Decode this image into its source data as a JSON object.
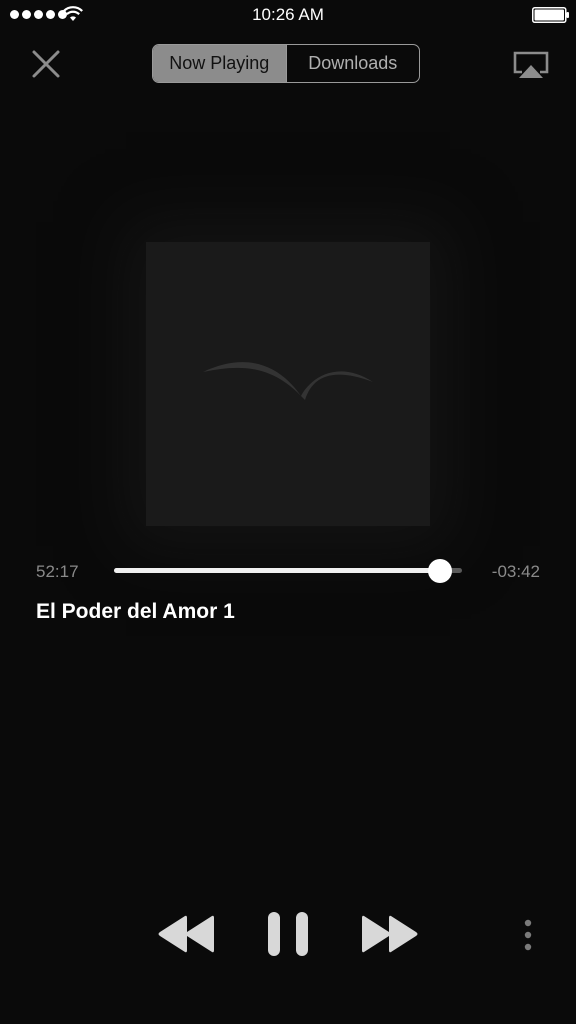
{
  "status_bar": {
    "time": "10:26 AM",
    "signal_bars": 5
  },
  "header": {
    "tabs": [
      {
        "label": "Now Playing",
        "selected": true
      },
      {
        "label": "Downloads",
        "selected": false
      }
    ],
    "close_icon": "close-icon",
    "airplay_icon": "airplay-icon"
  },
  "player": {
    "elapsed": "52:17",
    "remaining": "-03:42",
    "progress": 0.938,
    "title": "El Poder del Amor 1",
    "is_playing": true
  },
  "controls": {
    "rewind_icon": "rewind-icon",
    "pause_icon": "pause-icon",
    "forward_icon": "fast-forward-icon",
    "more_icon": "more-vertical-icon"
  },
  "colors": {
    "background": "#0a0a0a",
    "accent": "#ffffff",
    "muted": "#8a8a8a"
  }
}
